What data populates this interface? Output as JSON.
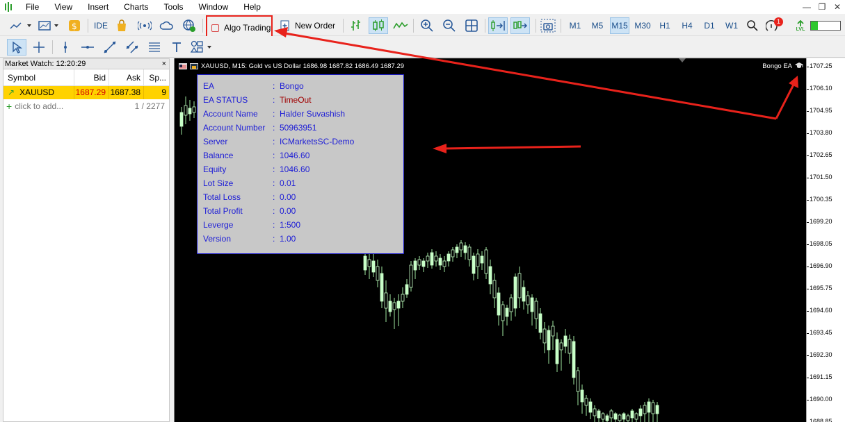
{
  "menu": [
    "File",
    "View",
    "Insert",
    "Charts",
    "Tools",
    "Window",
    "Help"
  ],
  "toolbar": {
    "ide_label": "IDE",
    "algo_trading_label": "Algo Trading",
    "new_order_label": "New Order",
    "timeframes": [
      "M1",
      "M5",
      "M15",
      "M30",
      "H1",
      "H4",
      "D1",
      "W1"
    ],
    "active_timeframe": "M15",
    "notification_count": "1",
    "lvl_label": "LVL"
  },
  "market_watch": {
    "title": "Market Watch: 12:20:29",
    "close": "×",
    "columns": [
      "Symbol",
      "Bid",
      "Ask",
      "Sp..."
    ],
    "rows": [
      {
        "symbol": "XAUUSD",
        "bid": "1687.29",
        "ask": "1687.38",
        "spread": "9"
      }
    ],
    "add_label": "click to add...",
    "count": "1 / 2277"
  },
  "chart": {
    "header": "XAUUSD, M15:  Gold vs US Dollar  1686.98 1687.82 1686.49 1687.29",
    "ea_name": "Bongo EA",
    "price_ticks": [
      "1707.25",
      "1706.10",
      "1704.95",
      "1703.80",
      "1702.65",
      "1701.50",
      "1700.35",
      "1699.20",
      "1698.05",
      "1696.90",
      "1695.75",
      "1694.60",
      "1693.45",
      "1692.30",
      "1691.15",
      "1690.00",
      "1688.85"
    ]
  },
  "ea_panel": {
    "rows": [
      {
        "key": "EA",
        "value": "Bongo"
      },
      {
        "key": "EA STATUS",
        "value": "TimeOut"
      },
      {
        "key": "Account Name",
        "value": "Halder Suvashish"
      },
      {
        "key": "Account Number",
        "value": "50963951"
      },
      {
        "key": "Server",
        "value": "ICMarketsSC-Demo"
      },
      {
        "key": "Balance",
        "value": "1046.60"
      },
      {
        "key": "Equity",
        "value": "1046.60"
      },
      {
        "key": "Lot Size",
        "value": "0.01"
      },
      {
        "key": "Total Loss",
        "value": "0.00"
      },
      {
        "key": "Total Profit",
        "value": "0.00"
      },
      {
        "key": "Leverge",
        "value": "1:500"
      },
      {
        "key": "Version",
        "value": "1.00"
      }
    ]
  },
  "colors": {
    "bull": "#c8ffc8",
    "bear": "#a6f0a6",
    "panel_text": "#1c1cd6",
    "status_red": "#a00000",
    "annotation": "#e8221b"
  }
}
